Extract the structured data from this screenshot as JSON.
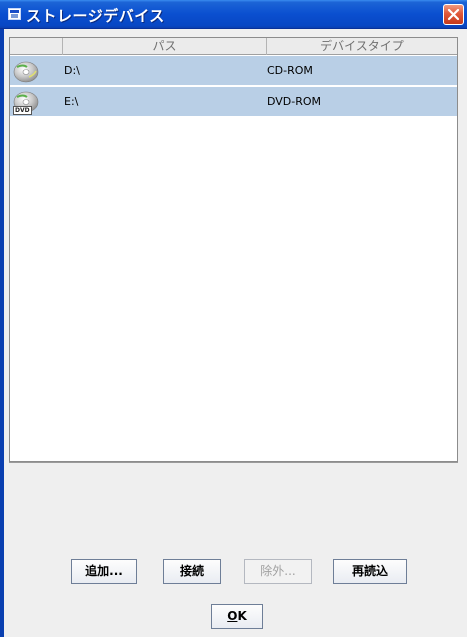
{
  "window": {
    "title": "ストレージデバイス"
  },
  "table": {
    "columns": [
      "",
      "パス",
      "デバイスタイプ"
    ],
    "rows": [
      {
        "icon": "cd-disc-icon",
        "path": "D:\\",
        "type": "CD-ROM",
        "badge": ""
      },
      {
        "icon": "dvd-disc-icon",
        "path": "E:\\",
        "type": "DVD-ROM",
        "badge": "DVD"
      }
    ]
  },
  "buttons": {
    "add": "追加...",
    "connect": "接続",
    "remove": "除外...",
    "reload": "再読込",
    "ok_mnemonic": "O",
    "ok_rest": "K"
  },
  "colors": {
    "titlebar": "#0a4fd0",
    "selection": "#b9cfe6",
    "close": "#e0583a"
  }
}
